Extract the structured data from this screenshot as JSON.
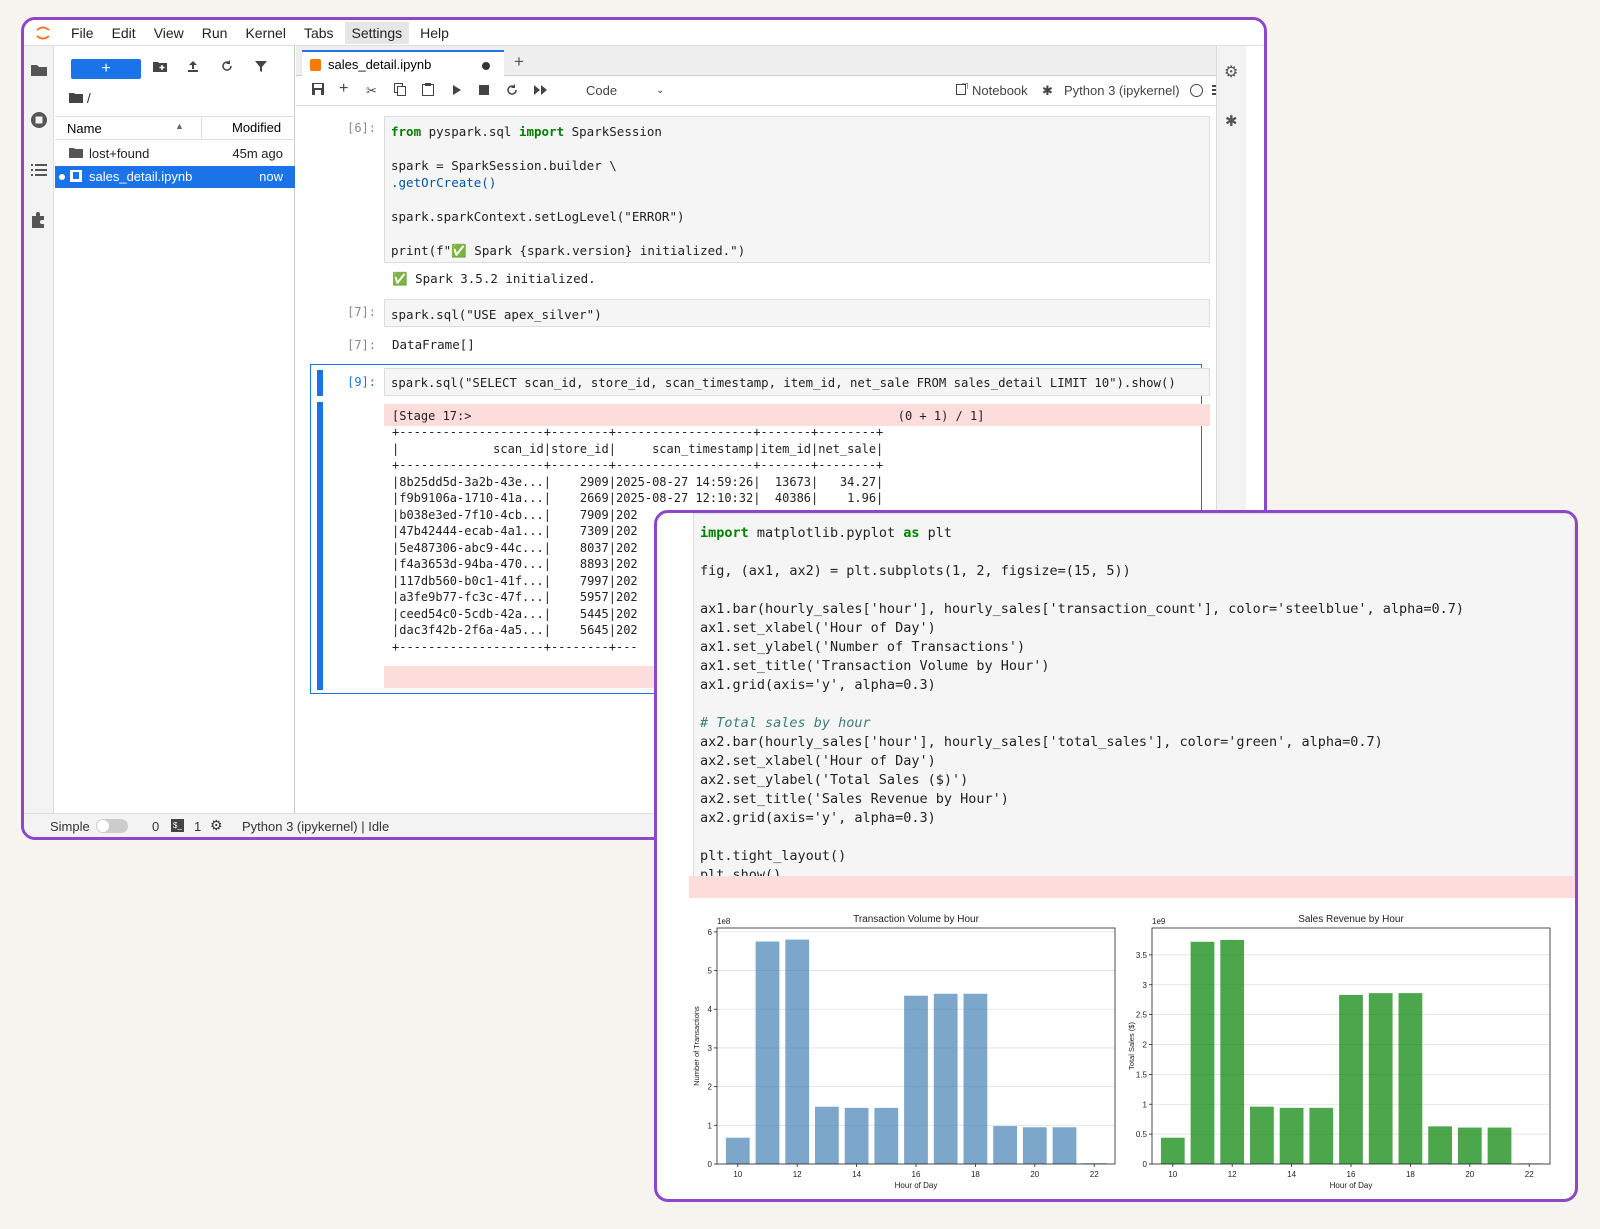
{
  "menu": [
    "File",
    "Edit",
    "View",
    "Run",
    "Kernel",
    "Tabs",
    "Settings",
    "Help"
  ],
  "filebrowser": {
    "new_label": "+",
    "breadcrumb": "/",
    "col_name": "Name",
    "col_modified": "Modified",
    "files": [
      {
        "name": "lost+found",
        "modified": "45m ago",
        "type": "folder"
      },
      {
        "name": "sales_detail.ipynb",
        "modified": "now",
        "type": "notebook"
      }
    ]
  },
  "tab": {
    "title": "sales_detail.ipynb"
  },
  "toolbar": {
    "cell_type": "Code",
    "notebook_label": "Notebook",
    "kernel": "Python 3 (ipykernel)"
  },
  "cells": {
    "c6_prompt": "[6]:",
    "c6_l1_kw": "from",
    "c6_l1_mid": " pyspark.sql ",
    "c6_l1_kw2": "import",
    "c6_l1_end": " SparkSession",
    "c6_l2": "spark = SparkSession.builder \\",
    "c6_l3": ".getOrCreate()",
    "c6_l4": "spark.sparkContext.setLogLevel(\"ERROR\")",
    "c6_l5": "print(f\"✅ Spark {spark.version} initialized.\")",
    "c6_out": "✅ Spark 3.5.2 initialized.",
    "c7_prompt": "[7]:",
    "c7_code": "spark.sql(\"USE apex_silver\")",
    "c7_out_prompt": "[7]:",
    "c7_out": "DataFrame[]",
    "c9_prompt": "[9]:",
    "c9_code": "spark.sql(\"SELECT scan_id, store_id, scan_timestamp, item_id, net_sale FROM sales_detail LIMIT 10\").show()",
    "c9_stage": "[Stage 17:>                                                           (0 + 1) / 1]",
    "c9_table": "+--------------------+--------+-------------------+-------+--------+\n|             scan_id|store_id|     scan_timestamp|item_id|net_sale|\n+--------------------+--------+-------------------+-------+--------+\n|8b25dd5d-3a2b-43e...|    2909|2025-08-27 14:59:26|  13673|   34.27|\n|f9b9106a-1710-41a...|    2669|2025-08-27 12:10:32|  40386|    1.96|\n|b038e3ed-7f10-4cb...|    7909|202\n|47b42444-ecab-4a1...|    7309|202\n|5e487306-abc9-44c...|    8037|202\n|f4a3653d-94ba-470...|    8893|202\n|117db560-b0c1-41f...|    7997|202\n|a3fe9b77-fc3c-47f...|    5957|202\n|ceed54c0-5cdb-42a...|    5445|202\n|dac3f42b-2f6a-4a5...|    5645|202\n+--------------------+--------+---"
  },
  "status": {
    "mode": "Simple",
    "terminals": "0",
    "kernels": "1",
    "kernel_status": "Python 3 (ipykernel) | Idle"
  },
  "plot_code": {
    "l1": "import matplotlib.pyplot as plt",
    "l2": "fig, (ax1, ax2) = plt.subplots(1, 2, figsize=(15, 5))",
    "l3": "ax1.bar(hourly_sales['hour'], hourly_sales['transaction_count'], color='steelblue', alpha=0.7)",
    "l4": "ax1.set_xlabel('Hour of Day')",
    "l5": "ax1.set_ylabel('Number of Transactions')",
    "l6": "ax1.set_title('Transaction Volume by Hour')",
    "l7": "ax1.grid(axis='y', alpha=0.3)",
    "l8": "# Total sales by hour",
    "l9": "ax2.bar(hourly_sales['hour'], hourly_sales['total_sales'], color='green', alpha=0.7)",
    "l10": "ax2.set_xlabel('Hour of Day')",
    "l11": "ax2.set_ylabel('Total Sales ($)')",
    "l12": "ax2.set_title('Sales Revenue by Hour')",
    "l13": "ax2.grid(axis='y', alpha=0.3)",
    "l14": "plt.tight_layout()",
    "l15": "plt.show()"
  },
  "chart_data": [
    {
      "type": "bar",
      "title": "Transaction Volume by Hour",
      "xlabel": "Hour of Day",
      "ylabel": "Number of Transactions",
      "scale_label": "1e8",
      "x": [
        10,
        11,
        12,
        13,
        14,
        15,
        16,
        17,
        18,
        19,
        20,
        21,
        22
      ],
      "values": [
        0.68,
        5.75,
        5.8,
        1.48,
        1.45,
        1.45,
        4.35,
        4.4,
        4.4,
        0.98,
        0.95,
        0.95,
        0.02
      ],
      "ylim": [
        0,
        6.1
      ],
      "yticks": [
        0,
        1,
        2,
        3,
        4,
        5,
        6
      ],
      "xticks": [
        10,
        12,
        14,
        16,
        18,
        20,
        22
      ],
      "color": "#4682b4"
    },
    {
      "type": "bar",
      "title": "Sales Revenue by Hour",
      "xlabel": "Hour of Day",
      "ylabel": "Total Sales ($)",
      "scale_label": "1e9",
      "x": [
        10,
        11,
        12,
        13,
        14,
        15,
        16,
        17,
        18,
        19,
        20,
        21,
        22
      ],
      "values": [
        0.44,
        3.72,
        3.75,
        0.96,
        0.94,
        0.94,
        2.83,
        2.86,
        2.86,
        0.63,
        0.61,
        0.61,
        0.01
      ],
      "ylim": [
        0,
        3.95
      ],
      "yticks": [
        0.0,
        0.5,
        1.0,
        1.5,
        2.0,
        2.5,
        3.0,
        3.5
      ],
      "xticks": [
        10,
        12,
        14,
        16,
        18,
        20,
        22
      ],
      "color": "#008000"
    }
  ]
}
